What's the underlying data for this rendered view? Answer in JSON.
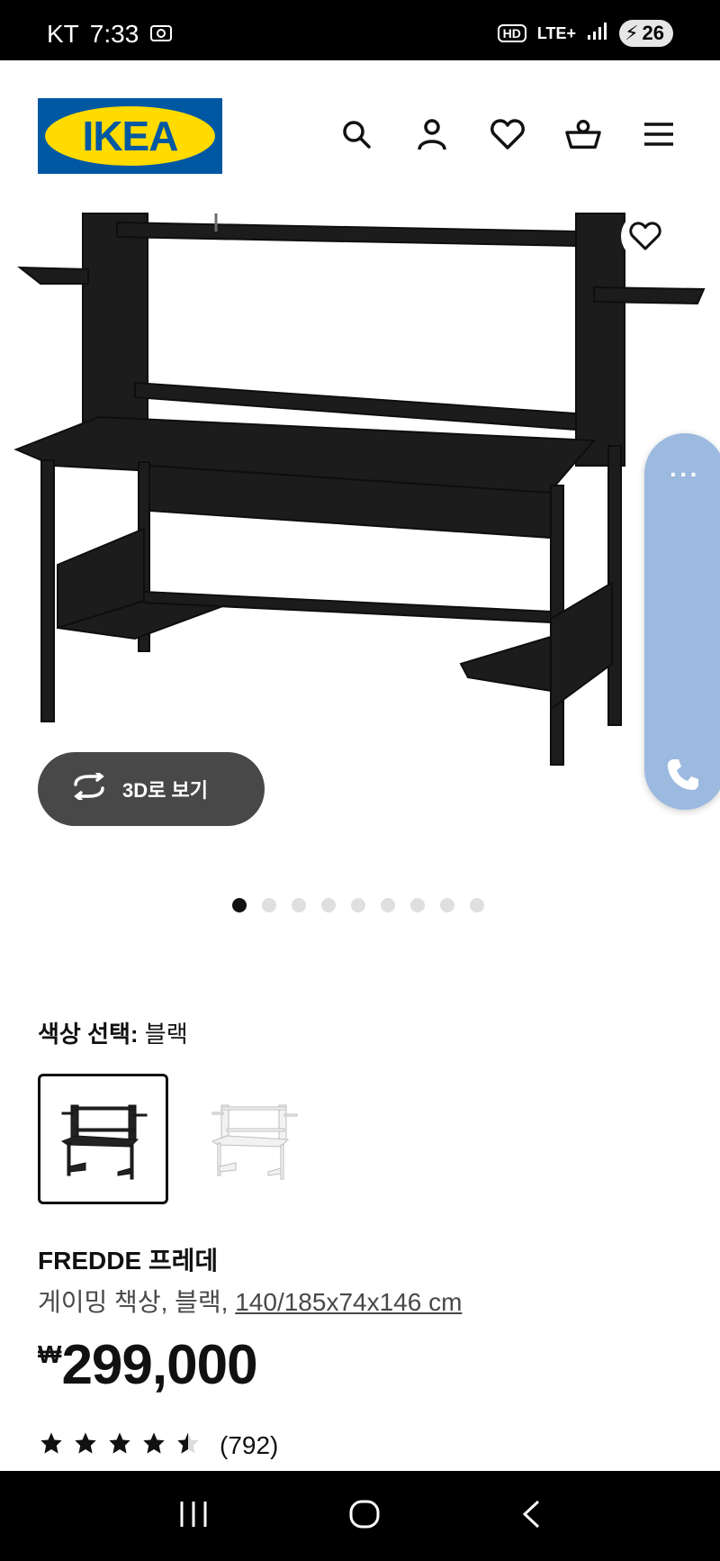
{
  "status_bar": {
    "carrier": "KT",
    "time": "7:33",
    "hd_label": "HD",
    "network": "LTE+",
    "battery": "26"
  },
  "header": {
    "logo_text": "IKEA",
    "icons": [
      "search-icon",
      "user-icon",
      "heart-icon",
      "basket-icon",
      "menu-icon"
    ]
  },
  "hero": {
    "view_3d_label": "3D로 보기",
    "side_menu_more": "···",
    "image_count": 9,
    "active_image": 1
  },
  "color_selection": {
    "label": "색상 선택:",
    "value": "블랙",
    "options": [
      "블랙",
      "화이트"
    ]
  },
  "product": {
    "name": "FREDDE 프레데",
    "description_prefix": "게이밍 책상, 블랙,",
    "dimensions": "140/185x74x146 cm",
    "currency": "₩",
    "price": "299,000",
    "rating": 4.5,
    "rating_max": 5,
    "review_count": "(792)"
  },
  "colors": {
    "ikea_blue": "#0058a3",
    "ikea_yellow": "#ffdb00",
    "button_dark": "#484848",
    "side_panel": "#9cb9e0"
  }
}
